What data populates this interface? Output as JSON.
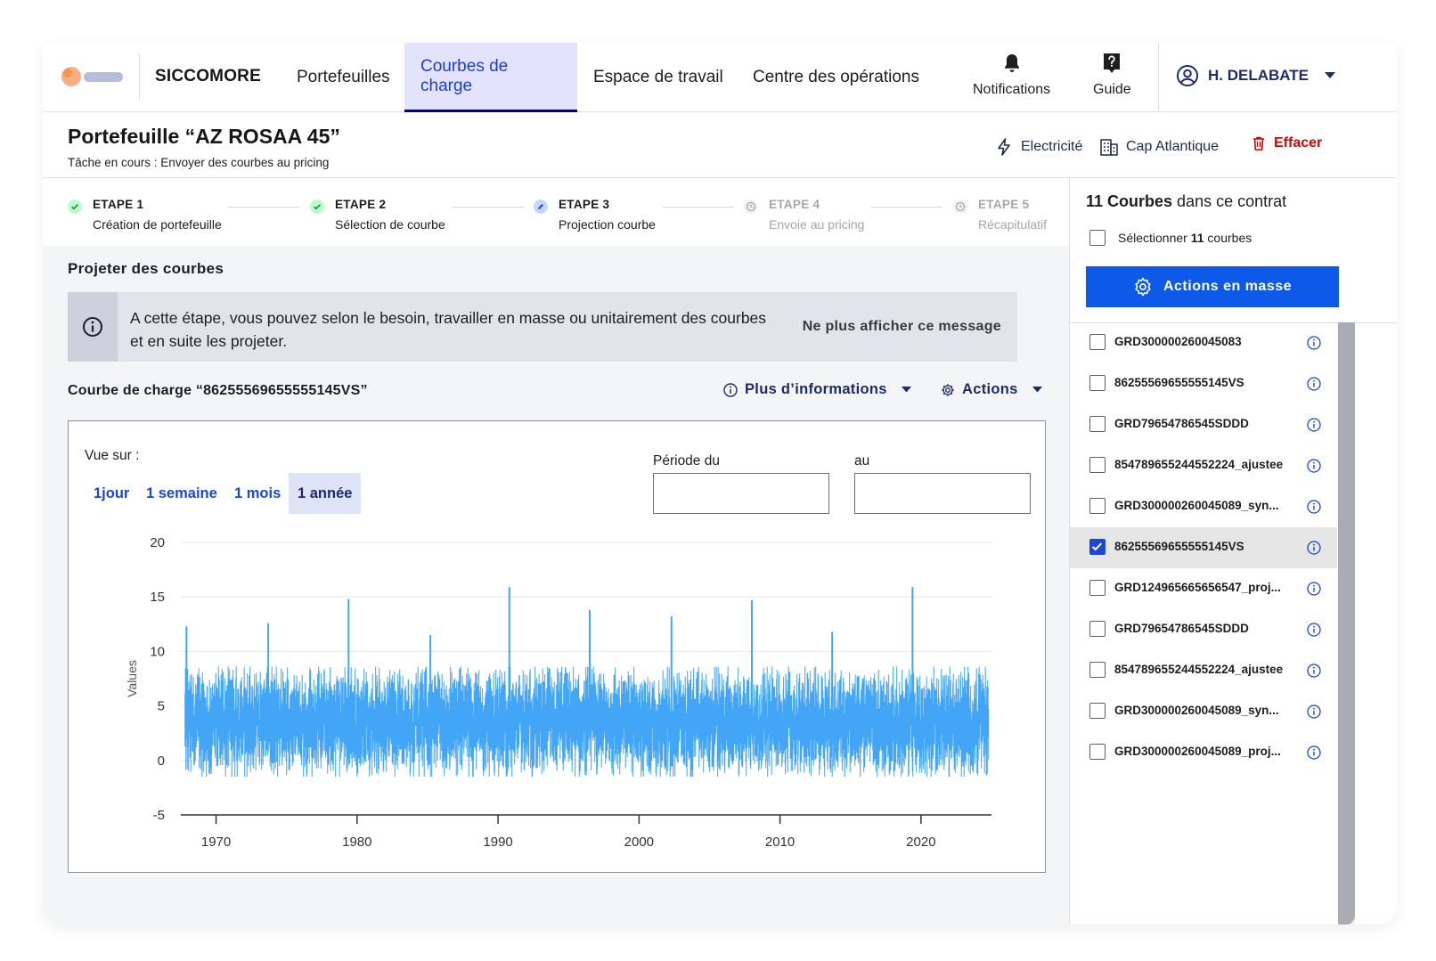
{
  "header": {
    "brand": "SICCOMORE",
    "nav": [
      {
        "label": "Portefeuilles",
        "active": false
      },
      {
        "label": "Courbes de charge",
        "active": true
      },
      {
        "label": "Espace de travail",
        "active": false
      },
      {
        "label": "Centre des opérations",
        "active": false
      }
    ],
    "notifications_label": "Notifications",
    "guide_label": "Guide",
    "user_name": "H. DELABATE"
  },
  "page": {
    "title": "Portefeuille “AZ ROSAA 45”",
    "task": "Tâche en cours : Envoyer des courbes au pricing",
    "energy": "Electricité",
    "site": "Cap Atlantique",
    "erase_label": "Effacer"
  },
  "steps": [
    {
      "name": "ETAPE 1",
      "desc": "Création de portefeuille",
      "status": "done"
    },
    {
      "name": "ETAPE 2",
      "desc": "Sélection de courbe",
      "status": "done"
    },
    {
      "name": "ETAPE 3",
      "desc": "Projection courbe",
      "status": "current"
    },
    {
      "name": "ETAPE 4",
      "desc": "Envoie au pricing",
      "status": "pending"
    },
    {
      "name": "ETAPE 5",
      "desc": "Récapitulatif",
      "status": "pending"
    }
  ],
  "main": {
    "section_title": "Projeter des courbes",
    "notice_text": "A cette étape, vous pouvez selon le besoin, travailler en masse ou unitairement des courbes et en suite les projeter.",
    "notice_dismiss": "Ne plus afficher ce message",
    "curve_title": "Courbe de charge “86255569655555145VS”",
    "more_info_label": "Plus d’informations",
    "actions_label": "Actions",
    "view_label": "Vue sur :",
    "ranges": [
      {
        "label": "1jour",
        "active": false
      },
      {
        "label": "1 semaine",
        "active": false
      },
      {
        "label": "1 mois",
        "active": false
      },
      {
        "label": "1 année",
        "active": true
      }
    ],
    "period_from_label": "Période du",
    "period_to_label": "au",
    "period_from_value": "",
    "period_to_value": ""
  },
  "chart_data": {
    "type": "line",
    "ylabel": "Values",
    "xlabel": "",
    "title": "",
    "ylim": [
      -5,
      20
    ],
    "yticks": [
      20,
      15,
      10,
      5,
      0,
      -5
    ],
    "xlim": [
      1967.5,
      2025
    ],
    "xticks": [
      1970,
      1980,
      1990,
      2000,
      2010,
      2020
    ],
    "grid": true,
    "color": "#42a5f5",
    "series": [
      {
        "baseline_min": 0,
        "baseline_max": 7,
        "x_start": 1967.8,
        "x_end": 2024.8,
        "spikes": [
          {
            "x": 1967.9,
            "y": 12.3
          },
          {
            "x": 1973.7,
            "y": 12.6
          },
          {
            "x": 1979.4,
            "y": 14.8
          },
          {
            "x": 1985.2,
            "y": 11.5
          },
          {
            "x": 1990.8,
            "y": 15.9
          },
          {
            "x": 1996.5,
            "y": 13.8
          },
          {
            "x": 2002.3,
            "y": 13.2
          },
          {
            "x": 2008.0,
            "y": 14.7
          },
          {
            "x": 2013.7,
            "y": 11.8
          },
          {
            "x": 2019.4,
            "y": 15.9
          }
        ]
      }
    ]
  },
  "sidebar": {
    "title_count": "11 Courbes",
    "title_rest": " dans ce contrat",
    "select_all_prefix": "Sélectionner ",
    "select_all_count": "11",
    "select_all_suffix": " courbes",
    "mass_actions_label": "Actions en masse",
    "curves": [
      {
        "label": "GRD300000260045083",
        "checked": false
      },
      {
        "label": "86255569655555145VS",
        "checked": false
      },
      {
        "label": "GRD79654786545SDDD",
        "checked": false
      },
      {
        "label": "854789655244552224_ajustee",
        "checked": false
      },
      {
        "label": "GRD300000260045089_syn...",
        "checked": false
      },
      {
        "label": "86255569655555145VS",
        "checked": true
      },
      {
        "label": "GRD124965665656547_proj...",
        "checked": false
      },
      {
        "label": "GRD79654786545SDDD",
        "checked": false
      },
      {
        "label": "854789655244552224_ajustee",
        "checked": false
      },
      {
        "label": "GRD300000260045089_syn...",
        "checked": false
      },
      {
        "label": "GRD300000260045089_proj...",
        "checked": false
      }
    ]
  }
}
